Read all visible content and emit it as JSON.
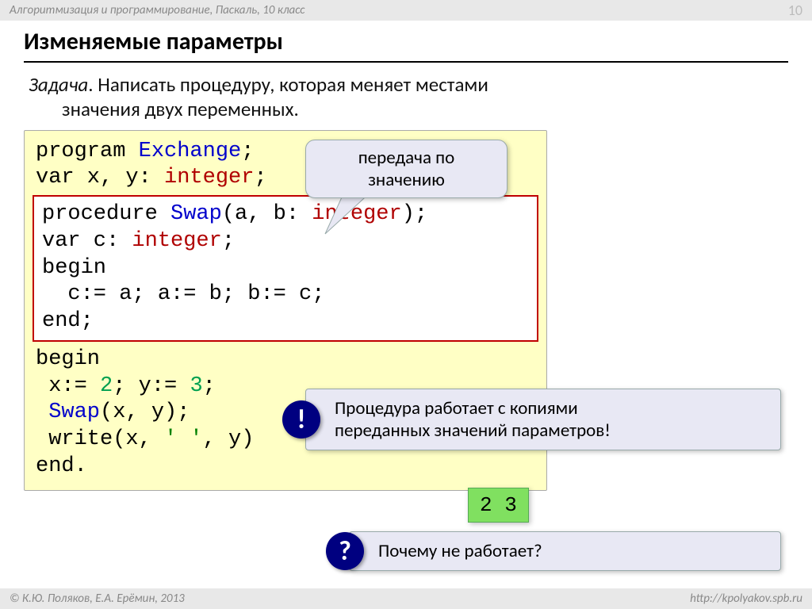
{
  "header": {
    "breadcrumb": "Алгоритмизация и программирование, Паскаль, 10 класс",
    "page": "10"
  },
  "title": "Изменяемые параметры",
  "task": {
    "label": "Задача",
    "line1": ". Написать процедуру, которая меняет местами",
    "line2": "значения двух переменных."
  },
  "code": {
    "l1_a": "program ",
    "l1_b": "Exchange",
    "l1_c": ";",
    "l2_a": "var x, y: ",
    "l2_b": "integer",
    "l2_c": ";",
    "p1_a": "procedure ",
    "p1_b": "Swap",
    "p1_c": "(a, b: ",
    "p1_d": "integer",
    "p1_e": ");",
    "p2_a": "var c: ",
    "p2_b": "integer",
    "p2_c": ";",
    "p3": "begin",
    "p4": "  c:= a; a:= b; b:= c;",
    "p5": "end;",
    "l3": "begin",
    "l4_a": " x:= ",
    "l4_b": "2",
    "l4_c": "; y:= ",
    "l4_d": "3",
    "l4_e": ";",
    "l5_a": " ",
    "l5_b": "Swap",
    "l5_c": "(x, y);",
    "l6_a": " write(x, ",
    "l6_b": "' '",
    "l6_c": ", y)",
    "l7": "end."
  },
  "bubble": {
    "l1": "передача по",
    "l2": "значению"
  },
  "note1": {
    "badge": "!",
    "l1": "Процедура работает с копиями",
    "l2": "переданных значений параметров!"
  },
  "output": "2 3",
  "note2": {
    "badge": "?",
    "text": "Почему не работает?"
  },
  "footer": {
    "left": "© К.Ю. Поляков, Е.А. Ерёмин, 2013",
    "right": "http://kpolyakov.spb.ru"
  }
}
